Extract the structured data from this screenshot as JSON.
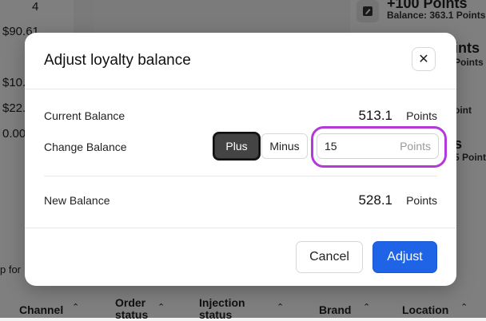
{
  "background": {
    "left_column": [
      "4",
      "$90.61",
      "$10.",
      "$22.",
      "0.00"
    ],
    "left_text": "p for",
    "right_items": [
      {
        "title": "+100 Points",
        "subtitle": "Balance: 363.1 Points"
      },
      {
        "title": "ints",
        "subtitle": "Points"
      },
      {
        "title": "",
        "subtitle": "oint"
      },
      {
        "title": "s",
        "subtitle": "5 Point"
      }
    ],
    "table_headers": [
      {
        "label": "Channel"
      },
      {
        "label": "Order\nstatus"
      },
      {
        "label": "Injection\nstatus"
      },
      {
        "label": "Brand"
      },
      {
        "label": "Location"
      }
    ]
  },
  "modal": {
    "title": "Adjust loyalty balance",
    "close_glyph": "✕",
    "current_balance": {
      "label": "Current Balance",
      "value": "513.1",
      "unit": "Points"
    },
    "change_balance": {
      "label": "Change Balance",
      "options": [
        "Plus",
        "Minus"
      ],
      "selected": "Plus",
      "input_value": "15",
      "input_suffix": "Points"
    },
    "new_balance": {
      "label": "New Balance",
      "value": "528.1",
      "unit": "Points"
    },
    "buttons": {
      "cancel": "Cancel",
      "adjust": "Adjust"
    }
  },
  "colors": {
    "accent": "#1f64e6",
    "highlight_ring": "#b23ad8",
    "selected_segment": "#444444"
  }
}
